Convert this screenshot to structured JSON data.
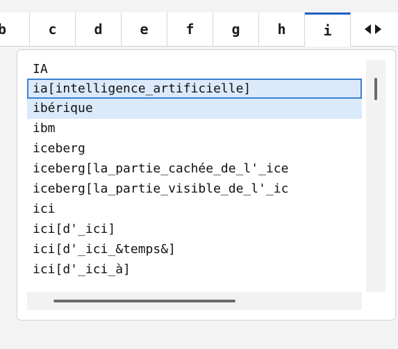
{
  "tabs": [
    {
      "label": "b"
    },
    {
      "label": "c"
    },
    {
      "label": "d"
    },
    {
      "label": "e"
    },
    {
      "label": "f"
    },
    {
      "label": "g"
    },
    {
      "label": "h"
    },
    {
      "label": "i"
    }
  ],
  "active_tab": "i",
  "nav": {
    "left_icon": "triangle-left-icon",
    "right_icon": "triangle-right-icon"
  },
  "list": {
    "items": [
      "IA",
      "ia[intelligence_artificielle]",
      "ibérique",
      "ibm",
      "iceberg",
      "iceberg[la_partie_cachée_de_l'_ice",
      "iceberg[la_partie_visible_de_l'_ic",
      "ici",
      "ici[d'_ici]",
      "ici[d'_ici_&temps&]",
      "ici[d'_ici_à]"
    ],
    "selected_item": "ia[intelligence_artificielle]",
    "hover_item": "ibérique"
  },
  "colors": {
    "accent": "#1f5fbf",
    "selection": "#dbeafb",
    "selection_border": "#3a7fd4"
  }
}
